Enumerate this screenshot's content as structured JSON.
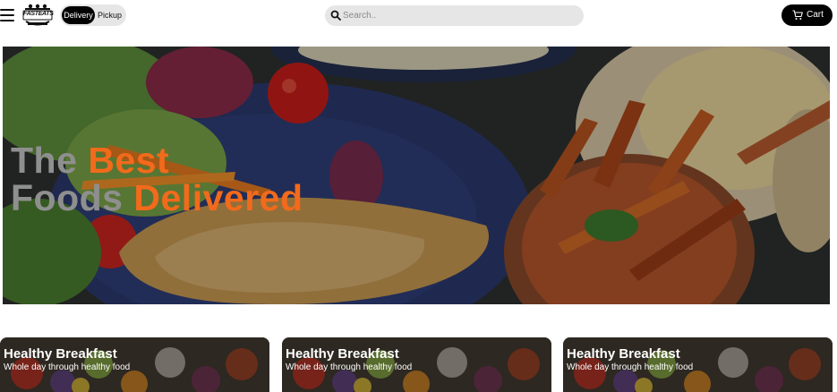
{
  "header": {
    "logo_text": "FASTEATS",
    "order_mode": {
      "options": [
        "Delivery",
        "Pickup"
      ],
      "selected": "Delivery"
    },
    "search": {
      "placeholder": "Search..",
      "value": ""
    },
    "cart_label": "Cart"
  },
  "hero": {
    "line1_white": "The",
    "line1_orange": "Best",
    "line2_white": "Foods",
    "line2_orange": "Delivered"
  },
  "cards": [
    {
      "title": "Healthy Breakfast",
      "subtitle": "Whole day through healthy food"
    },
    {
      "title": "Healthy Breakfast",
      "subtitle": "Whole day through healthy food"
    },
    {
      "title": "Healthy Breakfast",
      "subtitle": "Whole day through healthy food"
    }
  ],
  "colors": {
    "accent_orange": "#f26a1b",
    "toggle_active": "#000000",
    "pill_bg": "#e6e6e6"
  }
}
